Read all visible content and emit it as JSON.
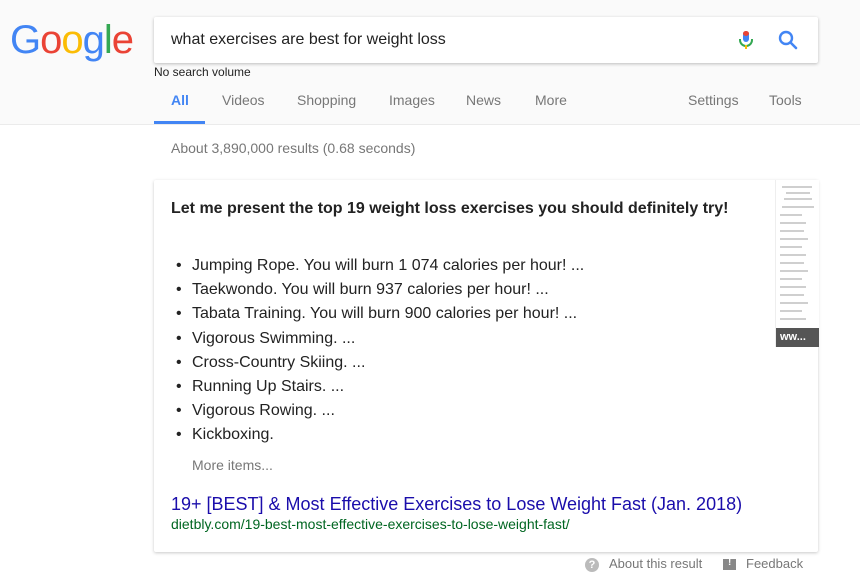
{
  "logo": {
    "letters": [
      "G",
      "o",
      "o",
      "g",
      "l",
      "e"
    ],
    "colors": [
      "#4285f4",
      "#ea4335",
      "#fbbc05",
      "#4285f4",
      "#34a853",
      "#ea4335"
    ]
  },
  "search": {
    "query": "what exercises are best for weight loss",
    "volume_note": "No search volume"
  },
  "tabs": {
    "all": "All",
    "videos": "Videos",
    "shopping": "Shopping",
    "images": "Images",
    "news": "News",
    "more": "More",
    "settings": "Settings",
    "tools": "Tools"
  },
  "stats": "About 3,890,000 results (0.68 seconds)",
  "snippet": {
    "title": "Let me present the top 19 weight loss exercises you should definitely try!",
    "items": [
      "Jumping Rope. You will burn 1 074 calories per hour! ...",
      "Taekwondo. You will burn 937 calories per hour! ...",
      "Tabata Training. You will burn 900 calories per hour! ...",
      "Vigorous Swimming. ...",
      "Cross-Country Skiing. ...",
      "Running Up Stairs. ...",
      "Vigorous Rowing. ...",
      "Kickboxing."
    ],
    "more_items": "More items...",
    "thumbnail_label": "ww...",
    "result_title": "19+ [BEST] & Most Effective Exercises to Lose Weight Fast (Jan. 2018)",
    "result_url": "dietbly.com/19-best-most-effective-exercises-to-lose-weight-fast/"
  },
  "footer": {
    "about": "About this result",
    "feedback": "Feedback"
  },
  "colors": {
    "accent": "#4285f4",
    "link": "#1a0dab",
    "url": "#006621"
  },
  "icons": {
    "mic": "microphone-icon",
    "search": "search-icon",
    "about": "question-icon",
    "feedback": "feedback-icon"
  }
}
